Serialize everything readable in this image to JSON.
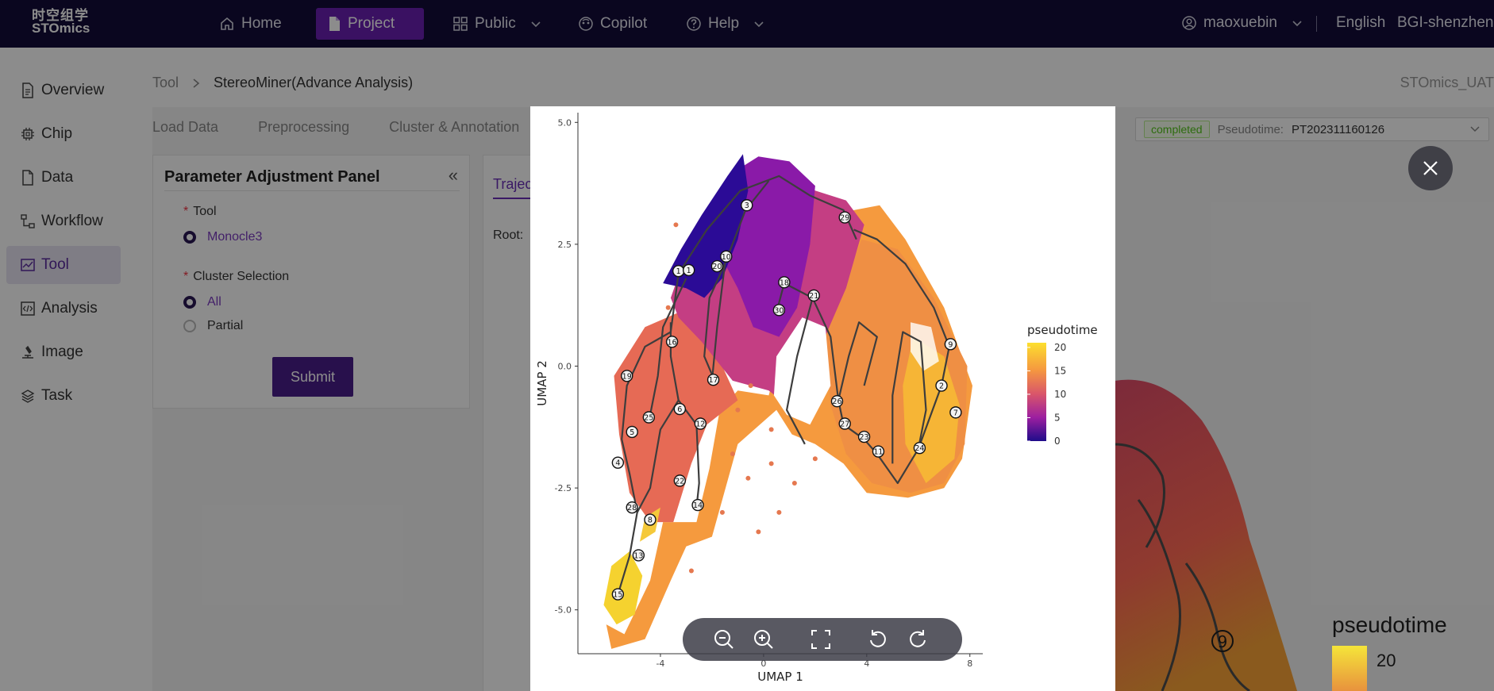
{
  "brand": {
    "cn": "时空组学",
    "en": "STOmics"
  },
  "nav": {
    "items": [
      {
        "label": "Home",
        "icon": "home-icon"
      },
      {
        "label": "Project",
        "icon": "document-icon"
      },
      {
        "label": "Public",
        "icon": "grid-icon"
      },
      {
        "label": "Copilot",
        "icon": "copilot-icon"
      },
      {
        "label": "Help",
        "icon": "help-icon"
      }
    ],
    "user": "maoxuebin",
    "language": "English",
    "org": "BGI-shenzhen"
  },
  "sidebar": {
    "items": [
      {
        "label": "Overview"
      },
      {
        "label": "Chip"
      },
      {
        "label": "Data"
      },
      {
        "label": "Workflow"
      },
      {
        "label": "Tool"
      },
      {
        "label": "Analysis"
      },
      {
        "label": "Image"
      },
      {
        "label": "Task"
      }
    ]
  },
  "breadcrumb": {
    "root": "Tool",
    "current": "StereoMiner(Advance Analysis)"
  },
  "project_name": "STOmics_UAT",
  "steps": [
    "Load Data",
    "Preprocessing",
    "Cluster & Annotation"
  ],
  "panel": {
    "title": "Parameter Adjustment Panel",
    "tool_label": "Tool",
    "tool_option": "Monocle3",
    "cluster_label": "Cluster Selection",
    "cluster_all": "All",
    "cluster_partial": "Partial",
    "submit": "Submit"
  },
  "result": {
    "tab": "Trajec",
    "root_label": "Root:",
    "status": "completed",
    "pseudotime_label": "Pseudotime:",
    "pseudotime_value": "PT202311160126"
  },
  "chart_data": {
    "type": "scatter",
    "xlabel": "UMAP 1",
    "ylabel": "UMAP 2",
    "x_ticks": [
      "-4",
      "0",
      "4",
      "8"
    ],
    "y_ticks": [
      "5.0",
      "2.5",
      "0.0",
      "-2.5",
      "-5.0"
    ],
    "xlim": [
      -7.2,
      8.5
    ],
    "ylim": [
      -5.9,
      5.2
    ],
    "legend": {
      "title": "pseudotime",
      "ticks": [
        "20",
        "15",
        "10",
        "5",
        "0"
      ],
      "range": [
        0,
        21
      ],
      "placement": "right"
    },
    "colors": {
      "low": "#1f0c8a",
      "mid": "#b8338f",
      "high": "#fcdf2e"
    },
    "nodes": [
      {
        "label": "1",
        "x": -3.3,
        "y": 1.95
      },
      {
        "label": "1",
        "x": -2.9,
        "y": 1.97
      },
      {
        "label": "3",
        "x": -0.65,
        "y": 3.3
      },
      {
        "label": "20",
        "x": -1.8,
        "y": 2.05
      },
      {
        "label": "10",
        "x": -1.45,
        "y": 2.25
      },
      {
        "label": "29",
        "x": 3.15,
        "y": 3.05
      },
      {
        "label": "18",
        "x": 0.8,
        "y": 1.72
      },
      {
        "label": "21",
        "x": 1.95,
        "y": 1.45
      },
      {
        "label": "30",
        "x": 0.6,
        "y": 1.15
      },
      {
        "label": "16",
        "x": -3.55,
        "y": 0.5
      },
      {
        "label": "9",
        "x": 7.25,
        "y": 0.45
      },
      {
        "label": "19",
        "x": -5.3,
        "y": -0.2
      },
      {
        "label": "17",
        "x": -1.95,
        "y": -0.28
      },
      {
        "label": "2",
        "x": 6.9,
        "y": -0.4
      },
      {
        "label": "26",
        "x": 2.85,
        "y": -0.72
      },
      {
        "label": "7",
        "x": 7.45,
        "y": -0.95
      },
      {
        "label": "6",
        "x": -3.25,
        "y": -0.88
      },
      {
        "label": "25",
        "x": -4.45,
        "y": -1.05
      },
      {
        "label": "12",
        "x": -2.45,
        "y": -1.18
      },
      {
        "label": "27",
        "x": 3.15,
        "y": -1.18
      },
      {
        "label": "5",
        "x": -5.1,
        "y": -1.35
      },
      {
        "label": "23",
        "x": 3.9,
        "y": -1.45
      },
      {
        "label": "11",
        "x": 4.45,
        "y": -1.75
      },
      {
        "label": "24",
        "x": 6.05,
        "y": -1.68
      },
      {
        "label": "4",
        "x": -5.65,
        "y": -1.98
      },
      {
        "label": "22",
        "x": -3.25,
        "y": -2.35
      },
      {
        "label": "14",
        "x": -2.55,
        "y": -2.85
      },
      {
        "label": "28",
        "x": -5.1,
        "y": -2.9
      },
      {
        "label": "8",
        "x": -4.4,
        "y": -3.15
      },
      {
        "label": "13",
        "x": -4.85,
        "y": -3.88
      },
      {
        "label": "15",
        "x": -5.65,
        "y": -4.68
      }
    ]
  },
  "background_plot": {
    "legend_title": "pseudotime",
    "legend_value": "20",
    "node_label": "9"
  },
  "viewer_tools": [
    "zoom-out-icon",
    "zoom-in-icon",
    "fullscreen-icon",
    "rotate-left-icon",
    "rotate-right-icon"
  ]
}
